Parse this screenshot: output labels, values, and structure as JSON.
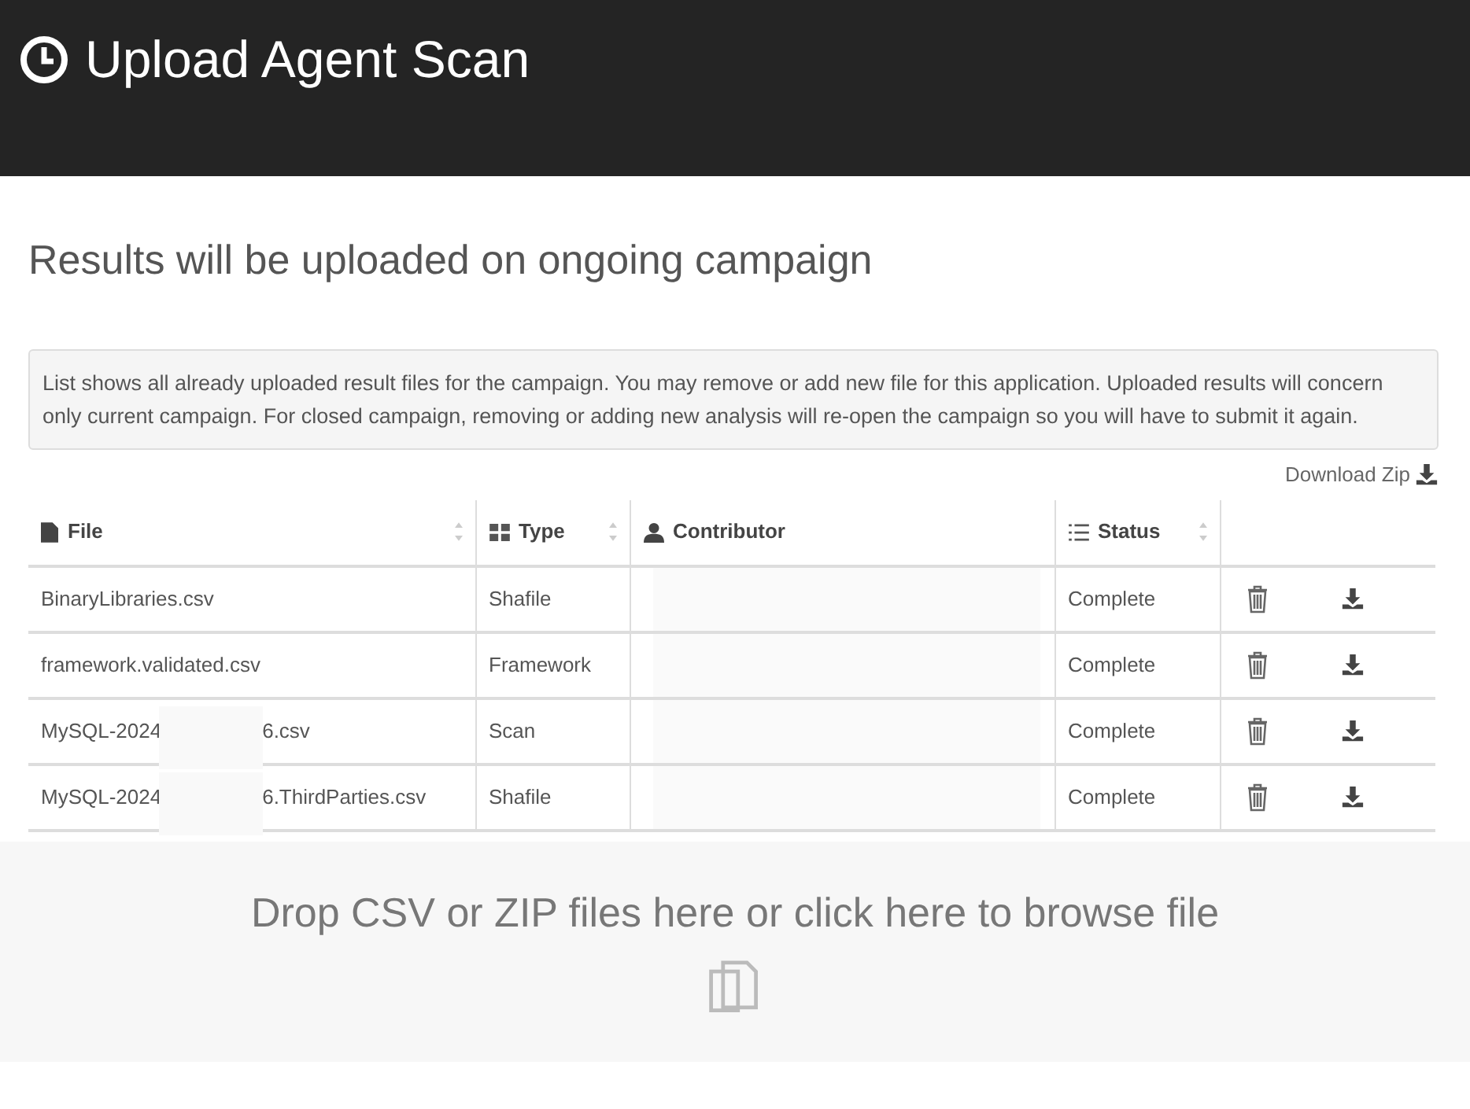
{
  "header": {
    "title": "Upload Agent Scan"
  },
  "subtitle": "Results will be uploaded on ongoing campaign",
  "info": "List shows all already uploaded result files for the campaign. You may remove or add new file for this application. Uploaded results will concern only current campaign. For closed campaign, removing or adding new analysis will re-open the campaign so you will have to submit it again.",
  "download_zip": "Download Zip",
  "table": {
    "columns": [
      "File",
      "Type",
      "Contributor",
      "Status"
    ],
    "rows": [
      {
        "file": "BinaryLibraries.csv",
        "type": "Shafile",
        "status": "Complete"
      },
      {
        "file": "framework.validated.csv",
        "type": "Framework",
        "status": "Complete"
      },
      {
        "file": "MySQL-2024",
        "file_end": "6.csv",
        "type": "Scan",
        "status": "Complete"
      },
      {
        "file": "MySQL-2024",
        "file_end": "6.ThirdParties.csv",
        "type": "Shafile",
        "status": "Complete"
      }
    ]
  },
  "dropzone": "Drop CSV or ZIP files here or click here to browse file"
}
